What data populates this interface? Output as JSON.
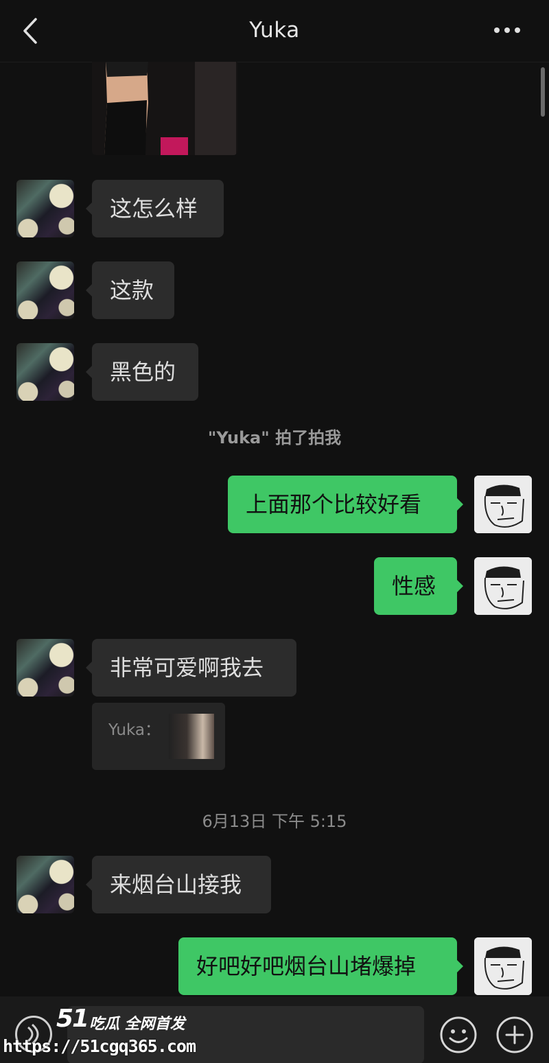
{
  "header": {
    "title": "Yuka",
    "back_icon": "chevron-left-icon",
    "more_icon": "more-dots-icon"
  },
  "messages": [
    {
      "side": "her",
      "text": "这怎么样"
    },
    {
      "side": "her",
      "text": "这款"
    },
    {
      "side": "her",
      "text": "黑色的"
    },
    {
      "side": "me",
      "text": "上面那个比较好看"
    },
    {
      "side": "me",
      "text": "性感"
    },
    {
      "side": "her",
      "text": "非常可爱啊我去"
    },
    {
      "side": "her",
      "text": "来烟台山接我"
    },
    {
      "side": "me",
      "text": "好吧好吧烟台山堵爆掉"
    }
  ],
  "system": {
    "pat_notice": "\"Yuka\" 拍了拍我",
    "timestamp": "6月13日 下午 5:15"
  },
  "quote": {
    "label": "Yuka："
  },
  "input_bar": {
    "voice_icon": "voice-icon",
    "emoji_icon": "emoji-icon",
    "plus_icon": "plus-icon"
  },
  "watermark": {
    "logo": "51",
    "slogan": "吃瓜 全网首发",
    "url": "https://51cgq365.com"
  },
  "colors": {
    "background": "#111111",
    "incoming_bubble": "#2c2c2c",
    "outgoing_bubble": "#3fc765"
  }
}
